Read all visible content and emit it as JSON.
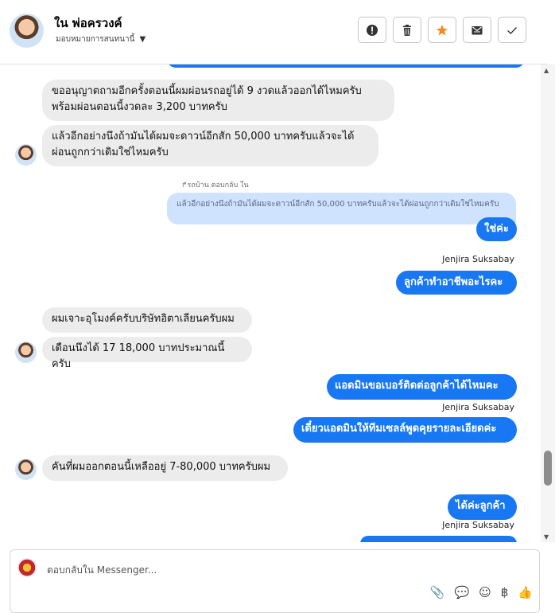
{
  "header": {
    "contact_name": "ใน พ่อครวงค์",
    "assign_label": "มอบหมายการสนทนานี้",
    "actions": [
      "mark-important",
      "delete",
      "star",
      "mark-unread",
      "done"
    ]
  },
  "messages": {
    "m1_line1": "ขออนุญาตถามอีกครั้งตอนนี้ผมผ่อนรถอยู่ได้ 9 งวดแล้วออกได้ไหมครับ",
    "m1_line2": "พร้อมผ่อนตอนนี้งวดละ 3,200 บาทครับ",
    "m2_line1": "แล้วอีกอย่างนึงถ้ามันได้ผมจะดาวน์อีกสัก 50,000 บาทครับแล้วจะได้",
    "m2_line2": "ผ่อนถูกกว่าเดิมใช่ไหมครับ",
    "reply_meta": "รถบ้าน ตอบกลับ ใน",
    "quote": "แล้วอีกอย่างนึงถ้ามันได้ผมจะดาวน์อีกสัก 50,000 บาทครับแล้วจะได้ผ่อนถูกกว่าเดิมใช่ไหมครับ",
    "r1": "ใช่ค่ะ",
    "sender": "Jenjira Suksabay",
    "r2": "ลูกค้าทำอาชีพอะไรคะ",
    "m3": "ผมเจาะอุโมงค์ครับบริษัทอิตาเลียนครับผม",
    "m4": "เดือนนึงได้ 17 18,000 บาทประมาณนี้ครับ",
    "r3": "แอดมินขอเบอร์ติดต่อลูกค้าได้ไหมคะ",
    "r4": "เดี๋ยวแอดมินให้ทีมเซลล์พูดคุยรายละเอียดค่ะ",
    "m5": "คันที่ผมออกตอนนี้เหลืออยู่ 7-80,000 บาทครับผม",
    "r5": "ได้ค่ะลูกค้า"
  },
  "composer": {
    "placeholder": "ตอบกลับใน Messenger..."
  },
  "colors": {
    "outgoing": "#1877f2",
    "incoming": "#ececec",
    "quote": "#cfe3ff",
    "star": "#f28b1e"
  }
}
